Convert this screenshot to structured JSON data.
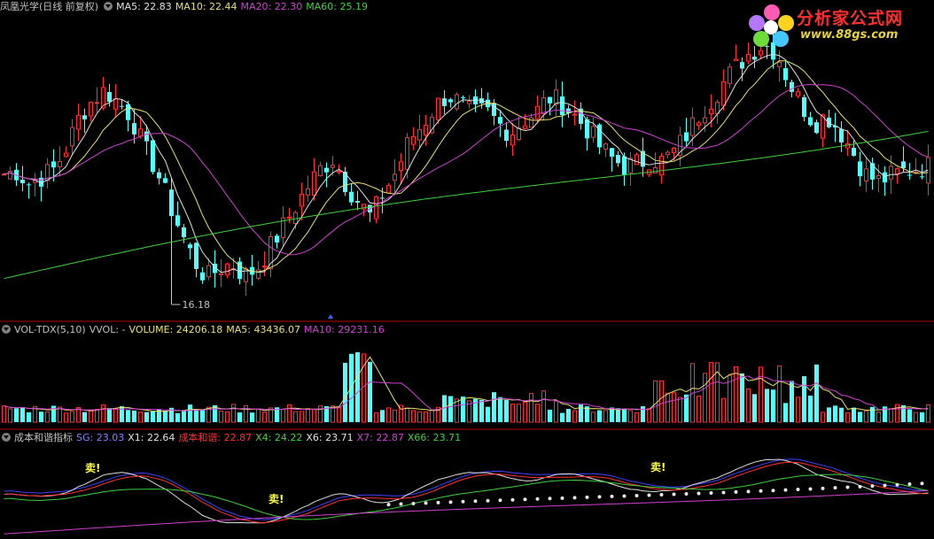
{
  "price_pane": {
    "stock_name": "凤凰光学(日线 前复权)",
    "indicators": [
      {
        "label": "MA5: 22.83",
        "color": "#e0e0e0"
      },
      {
        "label": "MA10: 22.44",
        "color": "#e8e070"
      },
      {
        "label": "MA20: 22.30",
        "color": "#d040d0"
      },
      {
        "label": "MA60: 25.19",
        "color": "#40d040"
      }
    ],
    "low_marker": "16.18"
  },
  "volume_pane": {
    "title": "VOL-TDX(5,10)",
    "indicators": [
      {
        "label": "VVOL: -",
        "color": "#c0c0c0"
      },
      {
        "label": "VOLUME: 24206.18",
        "color": "#e8e070"
      },
      {
        "label": "MA5: 43436.07",
        "color": "#e8e070"
      },
      {
        "label": "MA10: 29231.16",
        "color": "#d040d0"
      }
    ]
  },
  "indicator_pane": {
    "title": "成本和谐指标",
    "indicators": [
      {
        "label": "SG: 23.03",
        "color": "#8080ff"
      },
      {
        "label": "X1: 22.64",
        "color": "#e0e0e0"
      },
      {
        "label": "成本和谐: 22.87",
        "color": "#ff3030"
      },
      {
        "label": "X4: 24.22",
        "color": "#40d040"
      },
      {
        "label": "X6: 23.71",
        "color": "#e0e0e0"
      },
      {
        "label": "X7: 22.87",
        "color": "#d040d0"
      },
      {
        "label": "X66: 23.71",
        "color": "#40d040"
      }
    ],
    "sell_label": "卖!"
  },
  "logo": {
    "name": "分析家公式网",
    "url": "www.88gs.com"
  },
  "colors": {
    "up": "#ff3232",
    "down": "#54ffff",
    "ma5": "#e0e0e0",
    "ma10": "#e8e070",
    "ma20": "#d040d0",
    "ma60": "#40d040",
    "divider": "#b00000"
  },
  "chart_data": [
    {
      "type": "candlestick",
      "title": "凤凰光学(日线 前复权)",
      "min_label": 16.18,
      "y_range_approx": [
        15.5,
        27.5
      ],
      "ma_values_latest": {
        "MA5": 22.83,
        "MA10": 22.44,
        "MA20": 22.3,
        "MA60": 25.19
      },
      "close_path": [
        21.3,
        21.4,
        20.9,
        21.2,
        21.5,
        22.4,
        23.6,
        24.2,
        24.6,
        24.1,
        23.6,
        22.4,
        21.5,
        20.2,
        19.0,
        17.9,
        17.2,
        17.6,
        17.8,
        17.3,
        17.6,
        18.4,
        19.2,
        20.0,
        20.8,
        21.5,
        21.9,
        20.9,
        20.2,
        19.6,
        20.6,
        21.4,
        22.6,
        23.2,
        23.9,
        24.4,
        24.1,
        23.6,
        23.8,
        23.3,
        22.9,
        23.4,
        23.7,
        24.3,
        24.1,
        23.6,
        23.1,
        22.4,
        21.9,
        21.6,
        21.7,
        21.9,
        21.8,
        22.2,
        22.9,
        23.7,
        24.3,
        25.0,
        25.6,
        26.1,
        26.4,
        26.1,
        24.9,
        24.0,
        23.3,
        23.6,
        23.0,
        22.2,
        21.3,
        21.0,
        21.2,
        21.4,
        21.5,
        21.6
      ]
    },
    {
      "type": "bar",
      "title": "VOL-TDX(5,10)",
      "values_latest": {
        "VOLUME": 24206.18,
        "MA5": 43436.07,
        "MA10": 29231.16
      }
    },
    {
      "type": "line",
      "title": "成本和谐指标",
      "values_latest": {
        "SG": 23.03,
        "X1": 22.64,
        "成本和谐": 22.87,
        "X4": 24.22,
        "X6": 23.71,
        "X7": 22.87,
        "X66": 23.71
      }
    }
  ]
}
